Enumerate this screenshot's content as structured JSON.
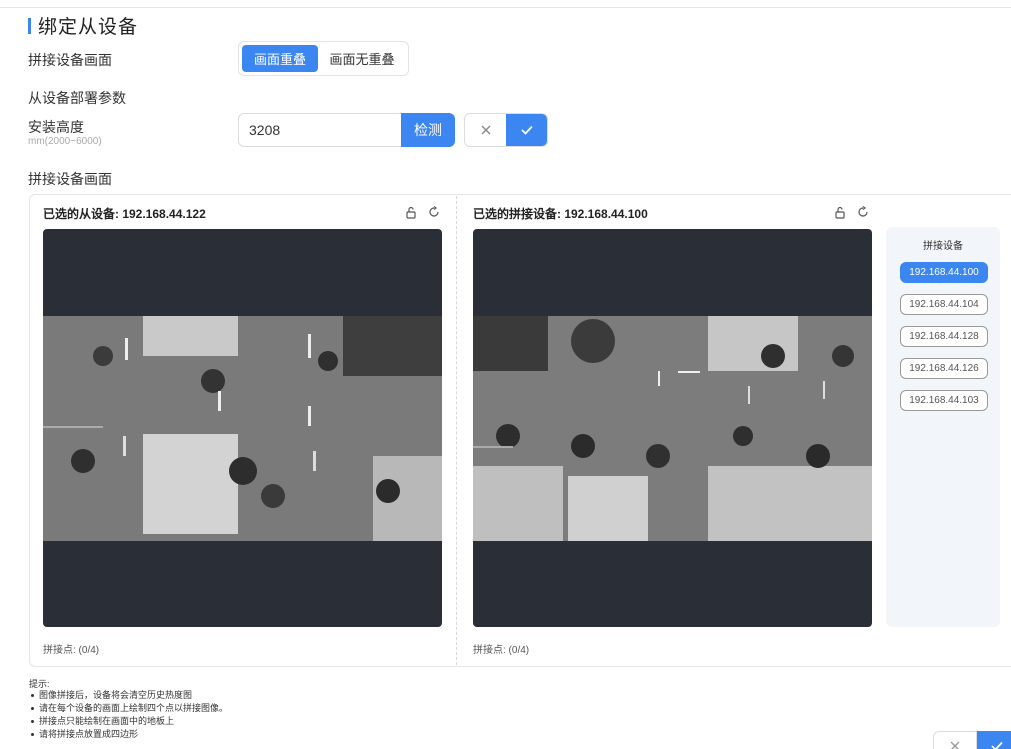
{
  "header": {
    "title": "绑定从设备"
  },
  "stitch_mode": {
    "label": "拼接设备画面",
    "options": [
      "画面重叠",
      "画面无重叠"
    ],
    "selected": "画面重叠"
  },
  "deploy": {
    "section_label": "从设备部署参数"
  },
  "height": {
    "label": "安装高度",
    "range_hint": "mm(2000~6000)",
    "value": "3208",
    "detect_label": "检测",
    "cancel_icon": "close-icon",
    "confirm_icon": "check-icon"
  },
  "preview": {
    "label": "拼接设备画面",
    "slave": {
      "title": "已选的从设备: 192.168.44.122",
      "points": "拼接点: (0/4)"
    },
    "stitch": {
      "title": "已选的拼接设备: 192.168.44.100",
      "points": "拼接点: (0/4)"
    },
    "icons": [
      "unlock-icon",
      "refresh-icon"
    ]
  },
  "device_list": {
    "title": "拼接设备",
    "items": [
      "192.168.44.100",
      "192.168.44.104",
      "192.168.44.128",
      "192.168.44.126",
      "192.168.44.103"
    ],
    "selected": "192.168.44.100"
  },
  "tips": {
    "title": "提示:",
    "items": [
      "图像拼接后，设备将会清空历史热度图",
      "请在每个设备的画面上绘制四个点以拼接图像。",
      "拼接点只能绘制在画面中的地板上",
      "请将拼接点放置成四边形"
    ]
  },
  "colors": {
    "accent": "#3b86f0",
    "screen_bg": "#2a2f37",
    "list_bg": "#f2f5fa"
  }
}
